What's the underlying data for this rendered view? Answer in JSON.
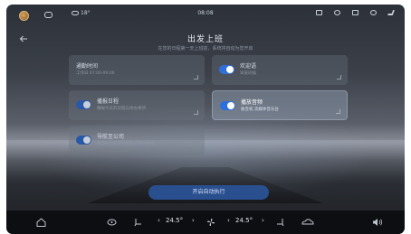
{
  "status_bar": {
    "temperature": "18°",
    "time": "08:08"
  },
  "header": {
    "title": "出发上班",
    "subtitle": "在您的日程第一天上班前，系统将自动为您开启"
  },
  "cards": [
    {
      "id": "commute-time",
      "title": "通勤时间",
      "subtitle": "工作日 07:00-09:00",
      "toggle": false,
      "active": false
    },
    {
      "id": "welcome",
      "title": "欢迎语",
      "subtitle": "早安问候",
      "toggle": true,
      "active": false
    },
    {
      "id": "schedule",
      "title": "播报日程",
      "subtitle": "播报今天的日程与待办事项",
      "toggle": true,
      "active": false,
      "dim": true
    },
    {
      "id": "play-audio",
      "title": "播放音频",
      "subtitle": "收音机 流媒体音乐台",
      "toggle": true,
      "active": true
    },
    {
      "id": "navigate-company",
      "title": "导航至公司",
      "subtitle": "将自动为您规划前往公司的路线",
      "toggle": true,
      "active": false,
      "dim": true
    }
  ],
  "start_button": {
    "label": "开启自动执行"
  },
  "dock": {
    "left_temp": "24.5°",
    "right_temp": "24.5°"
  },
  "colors": {
    "accent": "#2f6fdc",
    "button": "#2a4f8f"
  }
}
